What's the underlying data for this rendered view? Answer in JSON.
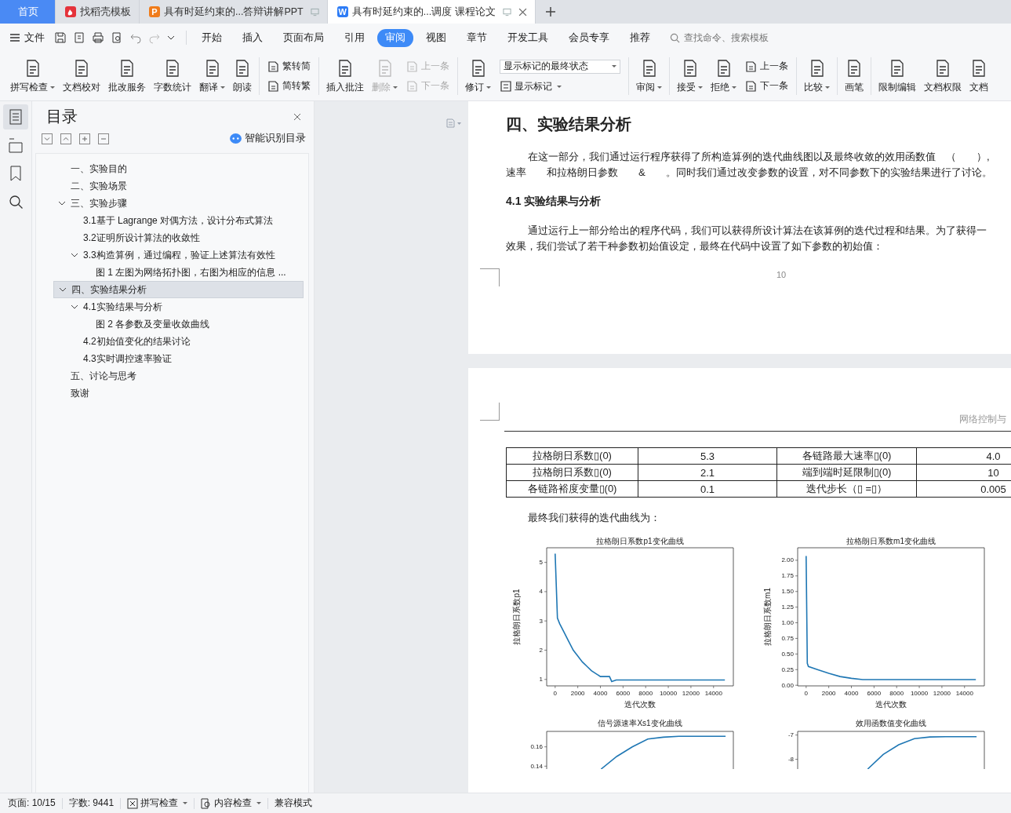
{
  "tabs": [
    {
      "label": "首页",
      "kind": "home",
      "selected": false
    },
    {
      "label": "找稻壳模板",
      "kind": "flame",
      "selected": false
    },
    {
      "label": "具有时延约束的...答辩讲解PPT",
      "kind": "letter",
      "letter": "P",
      "color": "#f07c1b",
      "selected": false
    },
    {
      "label": "具有时延约束的...调度 课程论文",
      "kind": "letter",
      "letter": "W",
      "color": "#2d7cf6",
      "selected": true
    }
  ],
  "menu": {
    "file": "文件",
    "tabs": [
      {
        "label": "开始",
        "selected": false
      },
      {
        "label": "插入",
        "selected": false
      },
      {
        "label": "页面布局",
        "selected": false
      },
      {
        "label": "引用",
        "selected": false
      },
      {
        "label": "审阅",
        "selected": true
      },
      {
        "label": "视图",
        "selected": false
      },
      {
        "label": "章节",
        "selected": false
      },
      {
        "label": "开发工具",
        "selected": false
      },
      {
        "label": "会员专享",
        "selected": false
      },
      {
        "label": "推荐",
        "selected": false
      }
    ],
    "search": {
      "placeholder": "查找命令、搜索模板"
    }
  },
  "ribbon": [
    {
      "kind": "large",
      "label": "拼写检查",
      "dropdown": true,
      "disabled": false
    },
    {
      "kind": "large",
      "label": "文档校对",
      "dropdown": false,
      "disabled": false
    },
    {
      "kind": "large",
      "label": "批改服务",
      "dropdown": false,
      "disabled": false
    },
    {
      "kind": "large",
      "label": "字数统计",
      "dropdown": false,
      "disabled": false
    },
    {
      "kind": "large",
      "label": "翻译",
      "dropdown": true,
      "disabled": false
    },
    {
      "kind": "large",
      "label": "朗读",
      "dropdown": false,
      "disabled": false
    },
    {
      "kind": "separator"
    },
    {
      "kind": "stack",
      "items": [
        {
          "label": "繁转简",
          "disabled": false
        },
        {
          "label": "简转繁",
          "disabled": false
        }
      ]
    },
    {
      "kind": "separator"
    },
    {
      "kind": "large",
      "label": "插入批注",
      "dropdown": false,
      "disabled": false
    },
    {
      "kind": "large",
      "label": "删除",
      "dropdown": true,
      "disabled": true
    },
    {
      "kind": "stack",
      "items": [
        {
          "label": "上一条",
          "disabled": true
        },
        {
          "label": "下一条",
          "disabled": true
        }
      ]
    },
    {
      "kind": "separator"
    },
    {
      "kind": "large",
      "label": "修订",
      "dropdown": true,
      "disabled": false
    },
    {
      "kind": "select",
      "value": "显示标记的最终状态",
      "label": "显示标记"
    },
    {
      "kind": "separator"
    },
    {
      "kind": "large",
      "label": "审阅",
      "dropdown": true,
      "disabled": false
    },
    {
      "kind": "separator"
    },
    {
      "kind": "large",
      "label": "接受",
      "dropdown": true,
      "disabled": false
    },
    {
      "kind": "large",
      "label": "拒绝",
      "dropdown": true,
      "disabled": false
    },
    {
      "kind": "stack",
      "items": [
        {
          "label": "上一条",
          "disabled": false
        },
        {
          "label": "下一条",
          "disabled": false
        }
      ]
    },
    {
      "kind": "separator"
    },
    {
      "kind": "large",
      "label": "比较",
      "dropdown": true,
      "disabled": false
    },
    {
      "kind": "separator"
    },
    {
      "kind": "large",
      "label": "画笔",
      "dropdown": false,
      "disabled": false
    },
    {
      "kind": "separator"
    },
    {
      "kind": "large",
      "label": "限制编辑",
      "dropdown": false,
      "disabled": false
    },
    {
      "kind": "large",
      "label": "文档权限",
      "dropdown": false,
      "disabled": false
    },
    {
      "kind": "large",
      "label": "文档",
      "dropdown": false,
      "disabled": false
    }
  ],
  "nav": {
    "title": "目录",
    "smart_toc": "智能识别目录",
    "items": [
      {
        "label": "一、实验目的",
        "selected": false
      },
      {
        "label": "二、实验场景",
        "selected": false
      },
      {
        "label": "三、实验步骤",
        "selected": false,
        "expanded": true,
        "children": [
          {
            "label": "3.1基于 Lagrange 对偶方法，设计分布式算法",
            "selected": false
          },
          {
            "label": "3.2证明所设计算法的收敛性",
            "selected": false
          },
          {
            "label": "3.3构造算例，通过编程，验证上述算法有效性",
            "selected": false,
            "expanded": true,
            "children": [
              {
                "label": "图 1  左图为网络拓扑图，右图为相应的信息 ...",
                "selected": false
              }
            ]
          }
        ]
      },
      {
        "label": "四、实验结果分析",
        "selected": true,
        "expanded": true,
        "children": [
          {
            "label": "4.1实验结果与分析",
            "selected": false,
            "expanded": true,
            "children": [
              {
                "label": "图 2 各参数及变量收敛曲线",
                "selected": false
              }
            ]
          },
          {
            "label": "4.2初始值变化的结果讨论",
            "selected": false
          },
          {
            "label": "4.3实时调控速率验证",
            "selected": false
          }
        ]
      },
      {
        "label": "五、讨论与思考",
        "selected": false
      },
      {
        "label": "致谢",
        "selected": false
      }
    ]
  },
  "document": {
    "heading": "四、实验结果分析",
    "paragraph_1": [
      "在这一部分，我们通过运行程序获得了所构造算例的迭代曲线图以及最终收敛的效用函数值　（　　）,",
      "速率　　和拉格朗日参数　　&　　。同时我们通过改变参数的设置，对不同参数下的实验结果进行了讨论。"
    ],
    "subheading": "4.1 实验结果与分析",
    "paragraph_2": [
      "通过运行上一部分给出的程序代码，我们可以获得所设计算法在该算例的迭代过程和结果。为了获得一",
      "效果，我们尝试了若干种参数初始值设定，最终在代码中设置了如下参数的初始值："
    ],
    "page_number": "10",
    "header": "网络控制与",
    "table": [
      [
        "拉格朗日系数▯(0)",
        "5.3",
        "各链路最大速率▯(0)",
        "4.0"
      ],
      [
        "拉格朗日系数▯(0)",
        "2.1",
        "端到端时延限制▯(0)",
        "10"
      ],
      [
        "各链路裕度变量▯(0)",
        "0.1",
        "迭代步长（▯ =▯）",
        "0.005"
      ]
    ],
    "caption": "最终我们获得的迭代曲线为：",
    "charts": [
      {
        "chart_data": {
          "type": "line",
          "title": "拉格朗日系数p1变化曲线",
          "xlabel": "迭代次数",
          "ylabel": "拉格朗日系数p1",
          "x": [
            0,
            200,
            400,
            800,
            1200,
            1600,
            2000,
            2400,
            2800,
            3200,
            3600,
            4000,
            4800,
            5000,
            5400,
            8000,
            12000,
            15000
          ],
          "series": [
            {
              "color": "#1f77b4",
              "values": [
                5.3,
                3.1,
                2.9,
                2.6,
                2.3,
                2.0,
                1.8,
                1.6,
                1.45,
                1.3,
                1.2,
                1.1,
                1.1,
                0.93,
                0.98,
                0.98,
                0.98,
                0.98
              ]
            }
          ],
          "xlim": [
            -750,
            15750
          ],
          "ylim": [
            0.78,
            5.5
          ],
          "xticks": [
            0,
            2000,
            4000,
            6000,
            8000,
            10000,
            12000,
            14000
          ],
          "yticks": [
            1,
            2,
            3,
            4,
            5
          ]
        }
      },
      {
        "chart_data": {
          "type": "line",
          "title": "拉格朗日系数m1变化曲线",
          "xlabel": "迭代次数",
          "ylabel": "拉格朗日系数m1",
          "x": [
            0,
            100,
            200,
            1000,
            2000,
            3000,
            4000,
            5000,
            5400,
            8000,
            12000,
            15000
          ],
          "series": [
            {
              "color": "#1f77b4",
              "values": [
                2.07,
                0.35,
                0.3,
                0.25,
                0.19,
                0.14,
                0.11,
                0.09,
                0.09,
                0.09,
                0.09,
                0.09
              ]
            }
          ],
          "xlim": [
            -750,
            15750
          ],
          "ylim": [
            -0.01,
            2.2
          ],
          "xticks": [
            0,
            2000,
            4000,
            6000,
            8000,
            10000,
            12000,
            14000
          ],
          "yticks": [
            {
              "value": 0,
              "label": "0.00"
            },
            {
              "value": 0.25,
              "label": "0.25"
            },
            {
              "value": 0.5,
              "label": "0.50"
            },
            {
              "value": 0.75,
              "label": "0.75"
            },
            {
              "value": 1,
              "label": "1.00"
            },
            {
              "value": 1.25,
              "label": "1.25"
            },
            {
              "value": 1.5,
              "label": "1.50"
            },
            {
              "value": 1.75,
              "label": "1.75"
            },
            {
              "value": 2,
              "label": "2.00"
            }
          ]
        }
      },
      {
        "chart_data": {
          "type": "line",
          "title": "信号源速率Xs1变化曲线",
          "series": [
            {
              "color": "#1f77b4",
              "values": [
                null,
                null,
                null,
                0.137,
                0.15,
                0.16,
                0.168,
                0.17,
                0.171,
                0.171,
                0.171,
                0.171
              ]
            }
          ],
          "ylim": [
            0.137,
            0.176
          ],
          "yticks": [
            0.14,
            0.16
          ]
        }
      },
      {
        "chart_data": {
          "type": "line",
          "title": "效用函数值变化曲线",
          "series": [
            {
              "color": "#1f77b4",
              "values": [
                null,
                null,
                null,
                null,
                -8.4,
                -7.8,
                -7.4,
                -7.15,
                -7.08,
                -7.07,
                -7.07,
                -7.07
              ]
            }
          ],
          "ylim": [
            -8.4,
            -6.85
          ],
          "yticks": [
            -8,
            -7
          ]
        }
      }
    ]
  },
  "status_bar": [
    {
      "kind": "text",
      "label": "页面: 10/15"
    },
    {
      "kind": "text",
      "label": "字数: 9441"
    },
    {
      "kind": "spell",
      "label": "拼写检查"
    },
    {
      "kind": "content",
      "label": "内容检查"
    },
    {
      "kind": "text",
      "label": "兼容模式"
    }
  ]
}
